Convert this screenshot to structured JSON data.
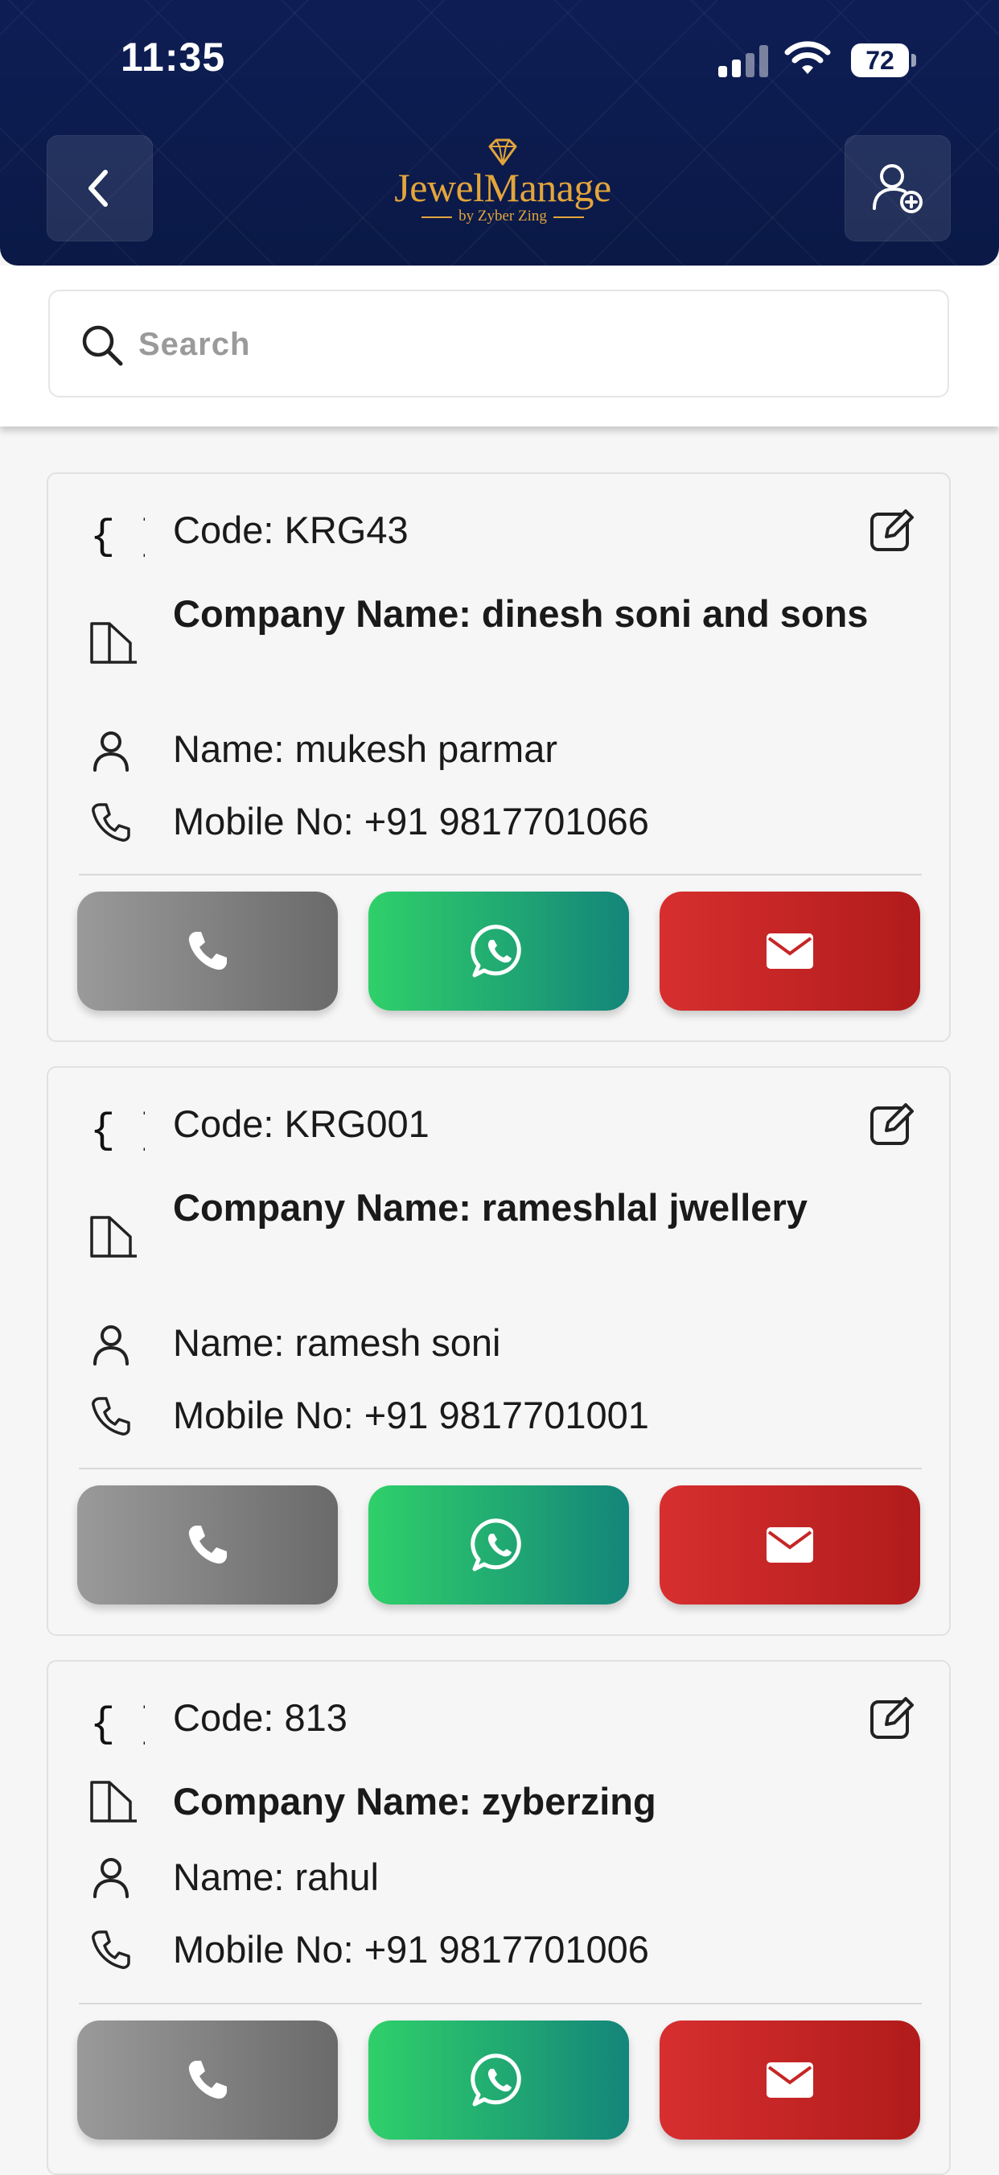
{
  "status_bar": {
    "time": "11:35",
    "battery": "72"
  },
  "header": {
    "brand": "JewelManage",
    "brand_sub": "by Zyber Zing",
    "accent": "#e3a53b",
    "background": "#0d1d52"
  },
  "search": {
    "placeholder": "Search",
    "value": ""
  },
  "contacts": [
    {
      "code": "Code: KRG43",
      "company": "Company Name: dinesh soni and sons",
      "name": "Name: mukesh parmar",
      "mobile": "Mobile No: +91 9817701066"
    },
    {
      "code": "Code: KRG001",
      "company": "Company Name: rameshlal jwellery",
      "name": "Name: ramesh soni",
      "mobile": "Mobile No: +91 9817701001"
    },
    {
      "code": "Code: 813",
      "company": "Company Name: zyberzing",
      "name": "Name: rahul",
      "mobile": "Mobile No: +91 9817701006"
    }
  ],
  "icons": {
    "code": "braces-icon",
    "company": "building-icon",
    "name": "person-icon",
    "mobile": "phone-icon",
    "edit": "edit-icon",
    "call": "phone-icon",
    "whatsapp": "whatsapp-icon",
    "email": "mail-icon"
  },
  "colors": {
    "call_button": "#7f7f7f",
    "whatsapp_button": "#22b36c",
    "email_button": "#c62626"
  }
}
